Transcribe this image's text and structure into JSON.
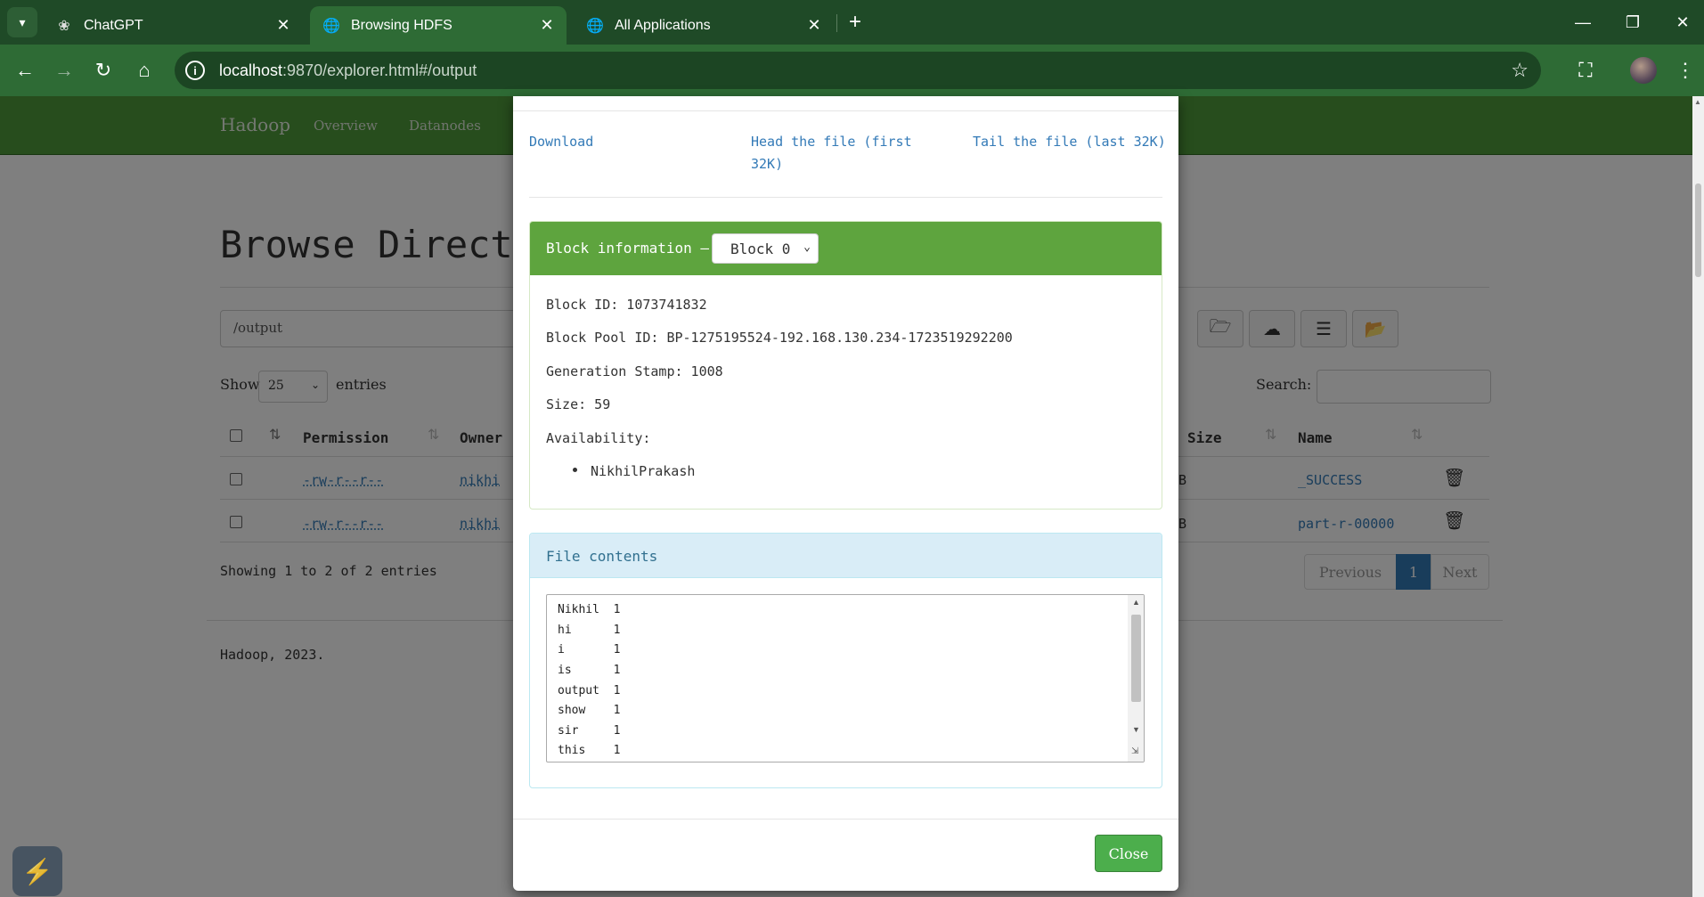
{
  "browser": {
    "tabs": [
      {
        "title": "ChatGPT",
        "icon": "chatgpt-icon"
      },
      {
        "title": "Browsing HDFS",
        "icon": "globe-icon"
      },
      {
        "title": "All Applications",
        "icon": "globe-icon"
      }
    ],
    "url_host": "localhost",
    "url_rest": ":9870/explorer.html#/output"
  },
  "hadoop_nav": {
    "brand": "Hadoop",
    "items": [
      "Overview",
      "Datanodes"
    ]
  },
  "page": {
    "title": "Browse Director",
    "path": "/output",
    "show_label": "Show",
    "show_value": "25",
    "entries_label": "entries",
    "search_label": "Search:",
    "columns": {
      "permission": "Permission",
      "owner": "Owner",
      "size": "Size",
      "name": "Name"
    },
    "rows": [
      {
        "permission": "-rw-r--r--",
        "owner": "nikhi",
        "size": "B",
        "name": "_SUCCESS"
      },
      {
        "permission": "-rw-r--r--",
        "owner": "nikhi",
        "size": "B",
        "name": "part-r-00000"
      }
    ],
    "showing": "Showing 1 to 2 of 2 entries",
    "pager": {
      "prev": "Previous",
      "current": "1",
      "next": "Next"
    },
    "footer": "Hadoop, 2023."
  },
  "modal": {
    "links": {
      "download": "Download",
      "head_line1": "Head the file (first",
      "head_line2": "32K)",
      "tail": "Tail the file (last 32K)"
    },
    "block": {
      "heading": "Block information —",
      "selected": "Block 0",
      "id": "Block ID: 1073741832",
      "pool": "Block Pool ID: BP-1275195524-192.168.130.234-1723519292200",
      "gen_stamp": "Generation Stamp: 1008",
      "size": "Size: 59",
      "availability": "Availability:",
      "nodes": [
        "NikhilPrakash"
      ]
    },
    "file_contents": {
      "heading": "File contents",
      "lines": [
        "Nikhil  1",
        "hi      1",
        "i       1",
        "is      1",
        "output  1",
        "show    1",
        "sir     1",
        "this    1"
      ]
    },
    "close_label": "Close"
  }
}
